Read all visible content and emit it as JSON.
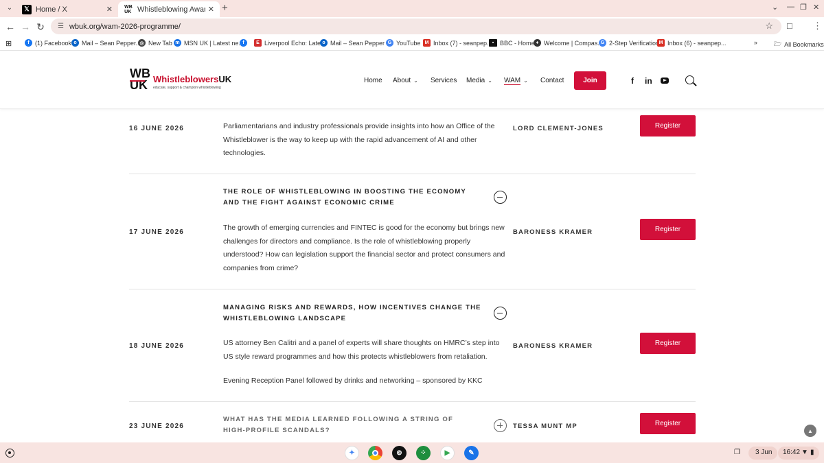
{
  "browser": {
    "tabs": [
      {
        "title": "Home / X",
        "icon": "x-logo-icon",
        "active": false
      },
      {
        "title": "Whistleblowing Awareness Mo",
        "icon": "wbuk-favicon-icon",
        "active": true
      }
    ],
    "url": "wbuk.org/wam-2026-programme/",
    "bookmarks": [
      {
        "label": "(1) Facebook",
        "icon": "facebook-icon",
        "color": "#1877f2"
      },
      {
        "label": "Mail – Sean Pepper...",
        "icon": "outlook-icon",
        "color": "#0a64c8"
      },
      {
        "label": "New Tab",
        "icon": "globe-icon",
        "color": "#444444"
      },
      {
        "label": "MSN UK | Latest ne...",
        "icon": "msn-icon",
        "color": "#1a73e8"
      },
      {
        "label": "",
        "icon": "facebook-icon",
        "color": "#1877f2"
      },
      {
        "label": "Liverpool Echo: Late...",
        "icon": "liverpool-echo-icon",
        "color": "#d32f2f"
      },
      {
        "label": "Mail – Sean Pepper -...",
        "icon": "outlook-icon",
        "color": "#0a64c8"
      },
      {
        "label": "YouTube",
        "icon": "google-icon",
        "color": "#4285f4"
      },
      {
        "label": "Inbox (7) - seanpep...",
        "icon": "gmail-icon",
        "color": "#d93025"
      },
      {
        "label": "BBC - Home",
        "icon": "bbc-icon",
        "color": "#111111"
      },
      {
        "label": "Welcome | Compas...",
        "icon": "compass-icon",
        "color": "#333333"
      },
      {
        "label": "2-Step Verification",
        "icon": "google-icon",
        "color": "#4285f4"
      },
      {
        "label": "Inbox (6) - seanpep...",
        "icon": "gmail-icon",
        "color": "#d93025"
      }
    ],
    "all_bookmarks": "All Bookmarks"
  },
  "site": {
    "logo": {
      "wb": "WB",
      "uk": "UK",
      "name_red": "Whistleblowers",
      "name_black": "UK",
      "tagline": "educate, support & champion whistleblowing"
    },
    "nav": {
      "home": "Home",
      "about": "About",
      "services": "Services",
      "media": "Media",
      "wam": "WAM",
      "contact": "Contact",
      "join": "Join"
    },
    "social": {
      "facebook": "f",
      "linkedin": "in"
    }
  },
  "programme": {
    "register_label": "Register",
    "rows": [
      {
        "date": "16 JUNE 2026",
        "title": "",
        "description": "Parliamentarians and industry professionals provide insights into how an Office of the Whistleblower is the way to keep up with the rapid advancement of AI and other technologies.",
        "description2": "",
        "speaker": "LORD CLEMENT-JONES",
        "expanded": true
      },
      {
        "date": "17 JUNE 2026",
        "title": "THE ROLE OF WHISTLEBLOWING IN BOOSTING THE ECONOMY AND THE FIGHT AGAINST ECONOMIC CRIME",
        "description": "The growth of emerging currencies and FINTEC is good for the economy but brings new challenges for directors and compliance. Is the role of whistleblowing properly understood? How can legislation support the financial sector and protect consumers and companies from crime?",
        "description2": "",
        "speaker": "BARONESS KRAMER",
        "expanded": true
      },
      {
        "date": "18 JUNE 2026",
        "title": "MANAGING RISKS AND REWARDS, HOW INCENTIVES CHANGE THE WHISTLEBLOWING LANDSCAPE",
        "description": "US attorney Ben Calitri and a panel of experts will share thoughts on HMRC’s step into US style reward programmes and how this protects whistleblowers from retaliation.",
        "description2": "Evening Reception Panel followed by drinks and networking – sponsored by KKC",
        "speaker": "BARONESS KRAMER",
        "expanded": true
      },
      {
        "date": "23 JUNE 2026",
        "title": "WHAT HAS THE MEDIA LEARNED FOLLOWING A STRING OF HIGH-PROFILE SCANDALS?",
        "description": "",
        "description2": "",
        "speaker": "TESSA MUNT MP",
        "expanded": false
      }
    ]
  },
  "shelf": {
    "date": "3 Jun",
    "time": "16:42",
    "apps": [
      "gemini-icon",
      "chrome-icon",
      "podcast-icon",
      "app-grid-icon",
      "play-store-icon",
      "messages-icon"
    ]
  },
  "colors": {
    "accent": "#d2103a",
    "logo_red": "#c8102e",
    "chrome_bg": "#f8e4e1"
  }
}
